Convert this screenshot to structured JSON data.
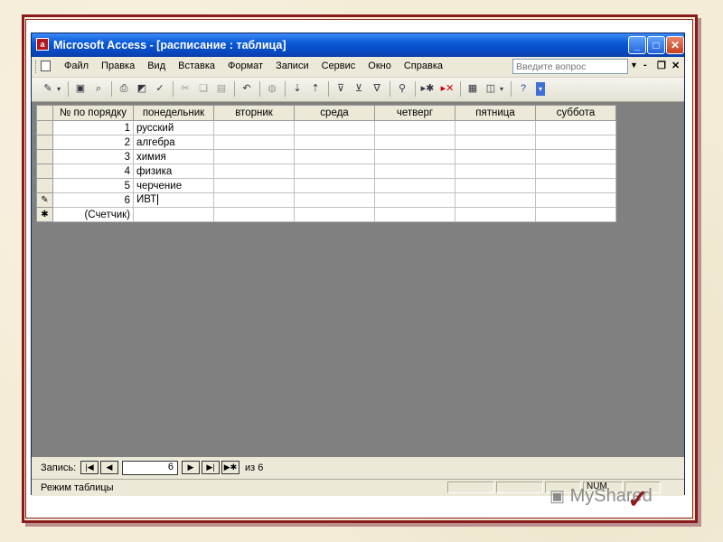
{
  "window": {
    "title": "Microsoft Access - [расписание : таблица]",
    "icon_glyph": "a"
  },
  "menubar": {
    "items": [
      "Файл",
      "Правка",
      "Вид",
      "Вставка",
      "Формат",
      "Записи",
      "Сервис",
      "Окно",
      "Справка"
    ],
    "help_placeholder": "Введите вопрос"
  },
  "grid": {
    "columns": [
      "№ по порядку",
      "понедельник",
      "вторник",
      "среда",
      "четверг",
      "пятница",
      "суббота"
    ],
    "rows": [
      {
        "num": "1",
        "monday": "русский"
      },
      {
        "num": "2",
        "monday": "алгебра"
      },
      {
        "num": "3",
        "monday": "химия"
      },
      {
        "num": "4",
        "monday": "физика"
      },
      {
        "num": "5",
        "monday": "черчение"
      },
      {
        "num": "6",
        "monday": "ИВТ"
      }
    ],
    "new_row_label": "(Счетчик)",
    "edit_marker": "✎",
    "new_marker": "✱"
  },
  "nav": {
    "record_label": "Запись:",
    "current": "6",
    "of_label": "из 6"
  },
  "status": {
    "mode": "Режим таблицы",
    "num": "NUM"
  },
  "watermark": {
    "text": "MyShared"
  },
  "colors": {
    "frame": "#8b1a1a",
    "titlebar": "#0a5ad6",
    "grid_bg": "#808080"
  }
}
